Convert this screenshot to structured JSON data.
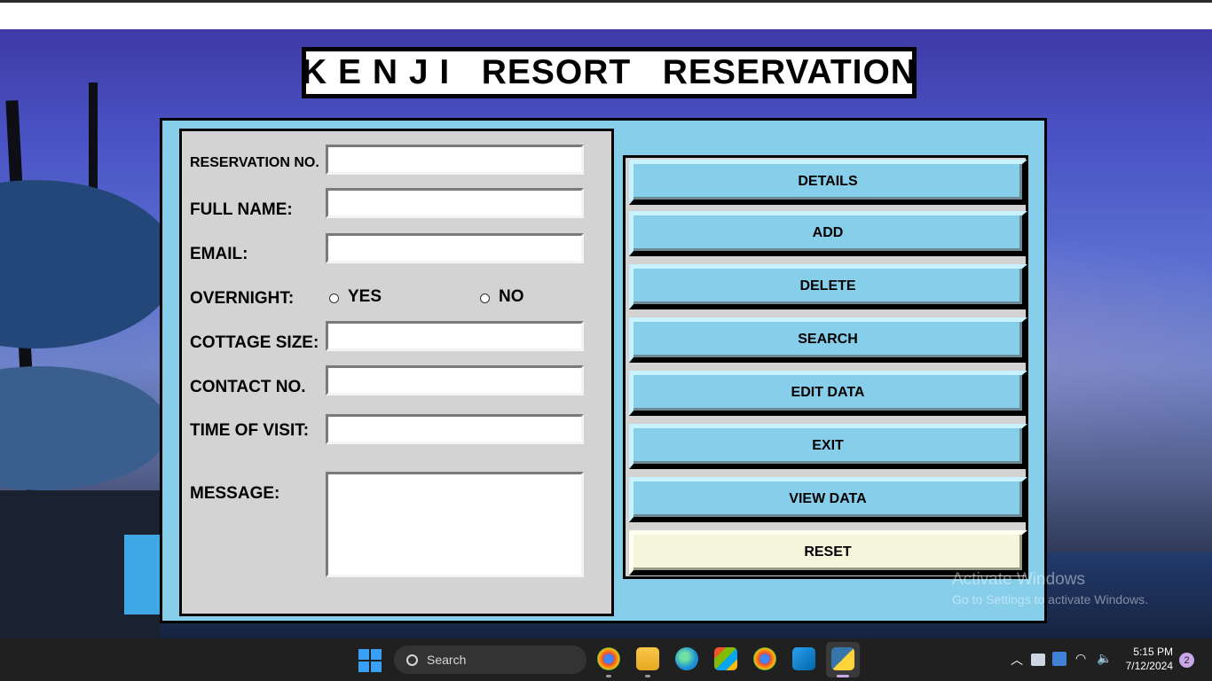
{
  "title": "K E N J I   RESORT   RESERVATION",
  "form": {
    "reservation_no_label": "RESERVATION NO.",
    "full_name_label": "FULL NAME:",
    "email_label": "EMAIL:",
    "overnight_label": "OVERNIGHT:",
    "yes_label": "YES",
    "no_label": "NO",
    "cottage_size_label": "COTTAGE SIZE:",
    "contact_no_label": "CONTACT NO.",
    "time_of_visit_label": "TIME OF VISIT:",
    "message_label": "MESSAGE:",
    "reservation_no_value": "",
    "full_name_value": "",
    "email_value": "",
    "cottage_size_value": "",
    "contact_no_value": "",
    "time_of_visit_value": "",
    "message_value": ""
  },
  "buttons": {
    "details": "DETAILS",
    "add": "ADD",
    "delete": "DELETE",
    "search": "SEARCH",
    "edit_data": "EDIT DATA",
    "exit": "EXIT",
    "view_data": "VIEW DATA",
    "reset": "RESET"
  },
  "watermark": {
    "line1": "Activate Windows",
    "line2": "Go to Settings to activate Windows."
  },
  "taskbar": {
    "search_label": "Search",
    "time": "5:15 PM",
    "date": "7/12/2024",
    "notification_count": "2",
    "icons": [
      "windows-start-icon",
      "chrome-icon",
      "file-explorer-icon",
      "edge-icon",
      "microsoft-store-icon",
      "chrome-icon",
      "vscode-icon",
      "python-icon"
    ]
  },
  "colors": {
    "frame_bg": "#87ceeb",
    "panel_bg": "#d3d3d3",
    "button_bg": "#87ceeb",
    "reset_bg": "#f5f5dc"
  }
}
